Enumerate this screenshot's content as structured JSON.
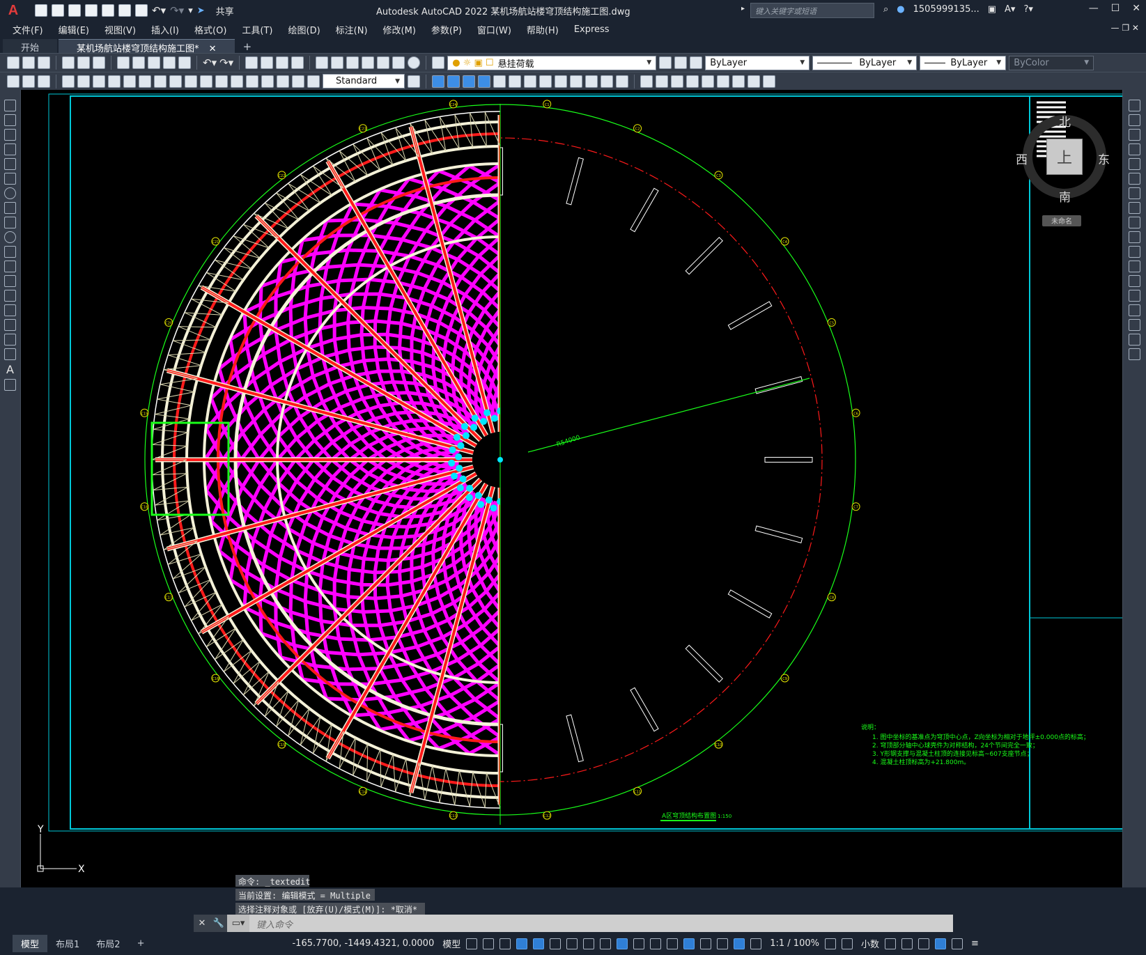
{
  "app": {
    "logo": "A",
    "title": "Autodesk AutoCAD 2022    某机场航站楼穹顶结构施工图.dwg",
    "share_label": "共享",
    "search_placeholder": "键入关键字或短语",
    "user": "1505999135...",
    "window_controls": [
      "—",
      "☐",
      "✕"
    ]
  },
  "menu": [
    "文件(F)",
    "编辑(E)",
    "视图(V)",
    "插入(I)",
    "格式(O)",
    "工具(T)",
    "绘图(D)",
    "标注(N)",
    "修改(M)",
    "参数(P)",
    "窗口(W)",
    "帮助(H)",
    "Express"
  ],
  "tabs": [
    {
      "label": "开始",
      "active": false
    },
    {
      "label": "某机场航站楼穹顶结构施工图*",
      "active": true
    }
  ],
  "toolbar1": {
    "layer_combo": "悬挂荷载",
    "color_combo": "ByLayer",
    "linetype_combo": "ByLayer",
    "lineweight_combo": "ByLayer",
    "plotstyle_combo": "ByColor"
  },
  "toolbar2": {
    "textstyle_combo": "Standard"
  },
  "viewcube": {
    "north": "北",
    "south": "南",
    "east": "东",
    "west": "西",
    "face": "上",
    "ucs": "未命名"
  },
  "drawing": {
    "radius_label": "R54000",
    "title_block": "A区穹顶结构布置图",
    "scale": "1:150",
    "notes_title": "说明：",
    "notes": [
      "1. 图中坐标的基准点为穹顶中心点，Z向坐标为相对于地坪±0.000点的标高；",
      "2. 穹顶部分轴中心球壳件为对称结构，24个节间完全一致；",
      "3. Y形钢支撑与混凝土柱顶的连接见标高~607支座节点；",
      "4. 混凝土柱顶标高为+21.800m。"
    ],
    "axis_labels": [
      "C1",
      "C2",
      "C3",
      "C4",
      "C5",
      "C6",
      "C7",
      "C8",
      "C9",
      "C10",
      "C11",
      "C12",
      "C13",
      "C14",
      "C15",
      "C16",
      "C17",
      "C18",
      "C19",
      "C20",
      "C21",
      "C22",
      "C23",
      "C24"
    ],
    "colors": {
      "magenta": "#ff00ff",
      "red": "#ff1a1a",
      "white": "#f4f1d8",
      "green": "#19ff19",
      "cyan": "#00e5ff",
      "frame": "#00c8d8"
    }
  },
  "ucs_icon": {
    "x": "X",
    "y": "Y"
  },
  "command": {
    "history": [
      "命令: _textedit",
      "当前设置: 编辑模式 = Multiple",
      "选择注释对象或 [放弃(U)/模式(M)]: *取消*"
    ],
    "input_placeholder": "键入命令"
  },
  "status": {
    "layouts": [
      "模型",
      "布局1",
      "布局2"
    ],
    "coords": "-165.7700, -1449.4321, 0.0000",
    "space": "模型",
    "scale": "1:1 / 100%",
    "units": "小数"
  }
}
